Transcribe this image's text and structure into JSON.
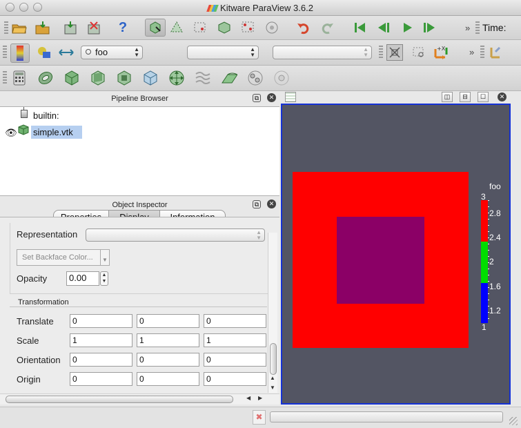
{
  "window": {
    "title": "Kitware ParaView 3.6.2",
    "logo_icon": "paraview-logo-icon"
  },
  "toolbar1": {
    "time_label": "Time:",
    "overflow": "»",
    "buttons": [
      "open-folder",
      "load-state",
      "save-state",
      "reset-session",
      "help",
      "interact-select",
      "select-cells",
      "select-points",
      "select-cells-frustum",
      "select-points-frustum",
      "select-block",
      "undo",
      "redo",
      "first-frame",
      "previous-frame",
      "play",
      "next-frame"
    ]
  },
  "toolbar2": {
    "color_by": {
      "icon": "point-data-icon",
      "value": "foo"
    },
    "representation_combo": {
      "value": ""
    },
    "secondary_combo": {
      "value": ""
    },
    "overflow": "»"
  },
  "toolbar3": {
    "buttons": [
      "calculator",
      "contour",
      "clip",
      "slice",
      "threshold",
      "extract-subset",
      "glyph",
      "stream-tracer",
      "warp",
      "group",
      "extract-level"
    ]
  },
  "pipeline_browser": {
    "title": "Pipeline Browser",
    "items": [
      {
        "label": "builtin:",
        "icon": "server-icon"
      },
      {
        "label": "simple.vtk",
        "icon": "dataset-cube-icon",
        "visible": true,
        "selected": true
      }
    ]
  },
  "object_inspector": {
    "title": "Object Inspector",
    "tabs": [
      "Properties",
      "Display",
      "Information"
    ],
    "active_tab": "Display",
    "representation_label": "Representation",
    "representation_value": "",
    "backface_button": "Set Backface Color...",
    "opacity_label": "Opacity",
    "opacity_value": "0.00",
    "transformation_title": "Transformation",
    "rows": [
      {
        "label": "Translate",
        "values": [
          "0",
          "0",
          "0"
        ]
      },
      {
        "label": "Scale",
        "values": [
          "1",
          "1",
          "1"
        ]
      },
      {
        "label": "Orientation",
        "values": [
          "0",
          "0",
          "0"
        ]
      },
      {
        "label": "Origin",
        "values": [
          "0",
          "0",
          "0"
        ]
      }
    ]
  },
  "render_view": {
    "background": "#535563",
    "outer_square_color": "#ff0000",
    "inner_square_color": "#8b0066",
    "legend": {
      "title": "foo",
      "range": [
        1,
        3
      ],
      "ticks": [
        "3",
        "2.8",
        "2.4",
        "2",
        "1.6",
        "1.2",
        "1"
      ],
      "colors": {
        "high": "#ff0000",
        "mid": "#00dd00",
        "low": "#0000ff"
      }
    }
  }
}
